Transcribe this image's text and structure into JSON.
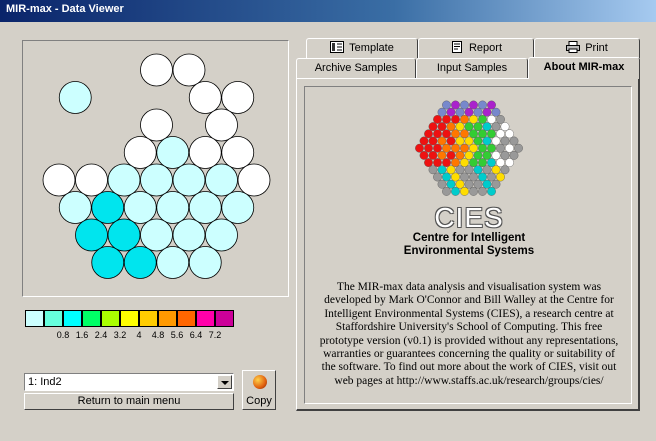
{
  "window": {
    "title": "MIR-max - Data Viewer"
  },
  "tabs": {
    "row_back": [
      {
        "label": "Template",
        "icon": "template-icon"
      },
      {
        "label": "Report",
        "icon": "report-icon"
      },
      {
        "label": "Print",
        "icon": "printer-icon"
      }
    ],
    "row_front": [
      {
        "label": "Archive Samples"
      },
      {
        "label": "Input Samples"
      },
      {
        "label": "About MIR-max",
        "active": true
      }
    ]
  },
  "map": {
    "colors": {
      "empty": "#ffffff",
      "light_cyan": "#ccffff",
      "cyan": "#00e5ee"
    },
    "cells": [
      {
        "col": 3,
        "row": 0,
        "color": "empty"
      },
      {
        "col": 4,
        "row": 0,
        "color": "empty"
      },
      {
        "col": 0,
        "row": 1,
        "color": "light_cyan"
      },
      {
        "col": 4,
        "row": 1,
        "color": "empty"
      },
      {
        "col": 5,
        "row": 1,
        "color": "empty"
      },
      {
        "col": 3,
        "row": 2,
        "color": "empty"
      },
      {
        "col": 5,
        "row": 2,
        "color": "empty"
      },
      {
        "col": 2,
        "row": 3,
        "color": "empty"
      },
      {
        "col": 3,
        "row": 3,
        "color": "light_cyan"
      },
      {
        "col": 4,
        "row": 3,
        "color": "empty"
      },
      {
        "col": 5,
        "row": 3,
        "color": "empty"
      },
      {
        "col": 0,
        "row": 4,
        "color": "empty"
      },
      {
        "col": 1,
        "row": 4,
        "color": "empty"
      },
      {
        "col": 2,
        "row": 4,
        "color": "light_cyan"
      },
      {
        "col": 3,
        "row": 4,
        "color": "light_cyan"
      },
      {
        "col": 4,
        "row": 4,
        "color": "light_cyan"
      },
      {
        "col": 5,
        "row": 4,
        "color": "light_cyan"
      },
      {
        "col": 6,
        "row": 4,
        "color": "empty"
      },
      {
        "col": 0,
        "row": 5,
        "color": "light_cyan"
      },
      {
        "col": 1,
        "row": 5,
        "color": "cyan"
      },
      {
        "col": 2,
        "row": 5,
        "color": "light_cyan"
      },
      {
        "col": 3,
        "row": 5,
        "color": "light_cyan"
      },
      {
        "col": 4,
        "row": 5,
        "color": "light_cyan"
      },
      {
        "col": 5,
        "row": 5,
        "color": "light_cyan"
      },
      {
        "col": 1,
        "row": 6,
        "color": "cyan"
      },
      {
        "col": 2,
        "row": 6,
        "color": "cyan"
      },
      {
        "col": 3,
        "row": 6,
        "color": "light_cyan"
      },
      {
        "col": 4,
        "row": 6,
        "color": "light_cyan"
      },
      {
        "col": 5,
        "row": 6,
        "color": "light_cyan"
      },
      {
        "col": 1,
        "row": 7,
        "color": "cyan"
      },
      {
        "col": 2,
        "row": 7,
        "color": "cyan"
      },
      {
        "col": 3,
        "row": 7,
        "color": "light_cyan"
      },
      {
        "col": 4,
        "row": 7,
        "color": "light_cyan"
      }
    ]
  },
  "legend": {
    "colors": [
      "#ccffff",
      "#66ffdd",
      "#00ffff",
      "#00ff66",
      "#aaff00",
      "#ffff00",
      "#ffcc00",
      "#ff9900",
      "#ff6600",
      "#ff00aa",
      "#cc0099"
    ],
    "labels": [
      "0.8",
      "1.6",
      "2.4",
      "3.2",
      "4",
      "4.8",
      "5.6",
      "6.4",
      "7.2"
    ]
  },
  "controls": {
    "sample_select": "1: Ind2",
    "main_menu_button": "Return to main menu",
    "copy_button": "Copy"
  },
  "about": {
    "logo_text": "CIES",
    "subtitle_line1": "Centre for Intelligent",
    "subtitle_line2": "Environmental Systems",
    "body": "The MIR-max data analysis and visualisation system was developed by Mark O'Connor and Bill Walley at the Centre for Intelligent Environmental Systems (CIES), a research centre at Staffordshire University's School of Computing. This free prototype version (v0.1) is provided without any representations, warranties or guarantees concerning the quality or suitability of the software. To find out more about the work of CIES, visit out web pages at http://www.staffs.ac.uk/research/groups/cies/",
    "hex_palette": [
      "#ee1111",
      "#ff7700",
      "#ffdd00",
      "#33cc33",
      "#00cccc",
      "#ffffff",
      "#7788cc",
      "#aa22cc",
      "#999999"
    ]
  }
}
